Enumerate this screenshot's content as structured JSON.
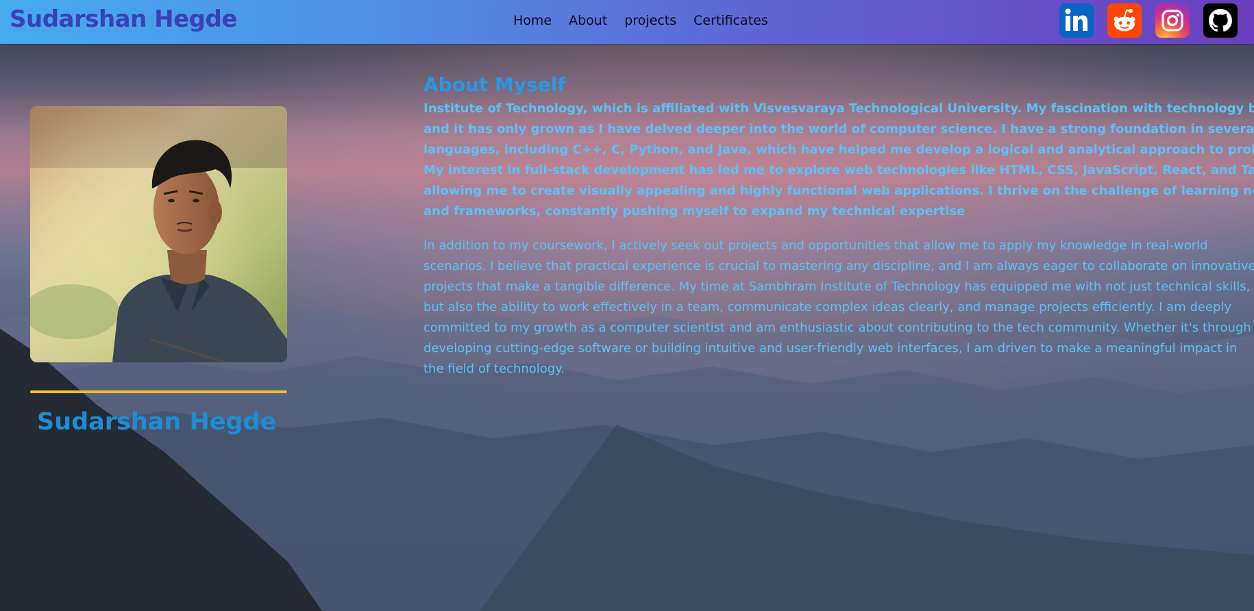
{
  "header": {
    "brand": "Sudarshan Hegde",
    "nav": [
      "Home",
      "About",
      "projects",
      "Certificates"
    ],
    "socials": [
      {
        "name": "linkedin",
        "icon": "linkedin-icon",
        "color": "#0a66c2"
      },
      {
        "name": "reddit",
        "icon": "reddit-icon",
        "color": "#ff4500"
      },
      {
        "name": "instagram",
        "icon": "instagram-icon",
        "color": "#e33b6c"
      },
      {
        "name": "github",
        "icon": "github-icon",
        "color": "#000000"
      }
    ]
  },
  "profile": {
    "name": "Sudarshan Hegde",
    "rule_color": "#f1c21b"
  },
  "about": {
    "title": "About Myself",
    "p1_lines": [
      "Institute of Technology, which is affiliated with Visvesvaraya Technological University. My fascination with technology began early on,",
      "and it has only grown as I have delved deeper into the world of computer science. I have a strong foundation in several programming",
      "languages, including C++, C, Python, and Java, which have helped me develop a logical and analytical approach to problem-solving.",
      "My interest in full-stack development has led me to explore web technologies like HTML, CSS, JavaScript, React, and Tailwind CSS,",
      "allowing me to create visually appealing and highly functional web applications. I thrive on the challenge of learning new languages",
      "and frameworks, constantly pushing myself to expand my technical expertise"
    ],
    "p2_lines": [
      "In addition to my coursework, I actively seek out projects and opportunities that allow me to apply my knowledge in real-world",
      "scenarios. I believe that practical experience is crucial to mastering any discipline, and I am always eager to collaborate on innovative",
      "projects that make a tangible difference. My time at Sambhram Institute of Technology has equipped me with not just technical skills,",
      "but also the ability to work effectively in a team, communicate complex ideas clearly, and manage projects efficiently. I am deeply",
      "committed to my growth as a computer scientist and am enthusiastic about contributing to the tech community. Whether it's through",
      "developing cutting-edge software or building intuitive and user-friendly web interfaces, I am driven to make a meaningful impact in",
      "the field of technology."
    ]
  },
  "colors": {
    "header_start": "#45aaf0",
    "header_end": "#6b3fc0",
    "brand": "#3b3fb8",
    "about_title": "#2a97e4",
    "about_text": "#5cc0f5",
    "name": "#1f8bd0"
  }
}
